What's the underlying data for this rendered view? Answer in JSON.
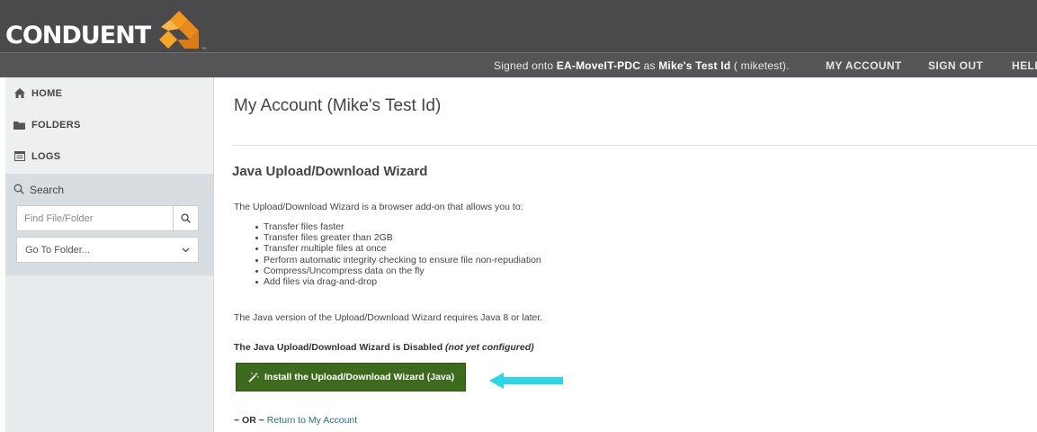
{
  "brand": {
    "logo_text": "CONDUENT",
    "trademark": "™"
  },
  "topbar": {
    "signed_prefix": "Signed onto ",
    "server": "EA-MoveIT-PDC",
    "signed_as": " as ",
    "user_name": "Mike's Test Id",
    "user_id": " ( miketest).",
    "links": [
      "MY ACCOUNT",
      "SIGN OUT",
      "HELP"
    ]
  },
  "sidebar": {
    "nav": [
      {
        "label": "HOME",
        "icon": "home-icon"
      },
      {
        "label": "FOLDERS",
        "icon": "folder-icon"
      },
      {
        "label": "LOGS",
        "icon": "logs-icon"
      }
    ],
    "search_title": "Search",
    "search_placeholder": "Find File/Folder",
    "goto_label": "Go To Folder..."
  },
  "main": {
    "page_title": "My Account (Mike's Test Id)",
    "section_title": "Java Upload/Download Wizard",
    "intro": "The Upload/Download Wizard is a browser add-on that allows you to:",
    "features": [
      "Transfer files faster",
      "Transfer files greater than 2GB",
      "Transfer multiple files at once",
      "Perform automatic integrity checking to ensure file non-repudiation",
      "Compress/Uncompress data on the fly",
      "Add files via drag-and-drop"
    ],
    "java_requirement": "The Java version of the Upload/Download Wizard requires Java 8 or later.",
    "status_label": "The Java Upload/Download Wizard is Disabled ",
    "status_note": "(not yet configured)",
    "install_button": "Install the Upload/Download Wizard (Java)",
    "or_text": "~ OR ~",
    "return_link": "Return to My Account"
  },
  "colors": {
    "header": "#4a4a4c",
    "topbar": "#555557",
    "install_button": "#3d6b1e",
    "arrow": "#29d7ea",
    "link": "#1f6f8a"
  }
}
